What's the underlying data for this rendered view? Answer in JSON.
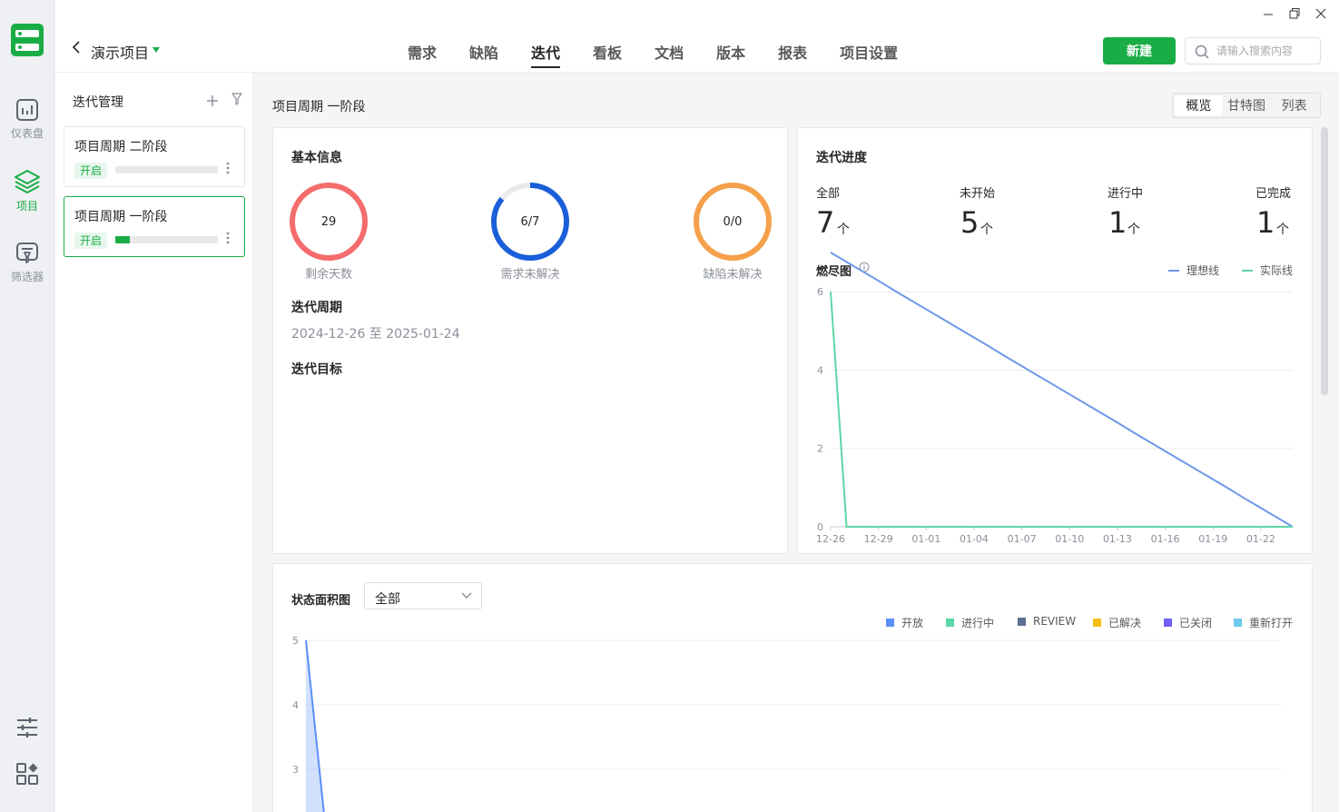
{
  "rail": {
    "items": [
      {
        "label": "仪表盘"
      },
      {
        "label": "项目"
      },
      {
        "label": "筛选器"
      }
    ]
  },
  "header": {
    "project_name": "演示项目",
    "tabs": [
      {
        "label": "需求"
      },
      {
        "label": "缺陷"
      },
      {
        "label": "迭代"
      },
      {
        "label": "看板"
      },
      {
        "label": "文档"
      },
      {
        "label": "版本"
      },
      {
        "label": "报表"
      },
      {
        "label": "项目设置"
      }
    ],
    "active_tab": "迭代",
    "new_label": "新建",
    "search_placeholder": "请输入搜索内容",
    "accent": "#1aad46"
  },
  "iterations": {
    "title": "迭代管理",
    "items": [
      {
        "name": "项目周期 二阶段",
        "status": "开启",
        "progress": 0.0
      },
      {
        "name": "项目周期 一阶段",
        "status": "开启",
        "progress": 0.14
      }
    ]
  },
  "main": {
    "breadcrumb": "项目周期 一阶段",
    "views": [
      "概览",
      "甘特图",
      "列表"
    ],
    "active_view": "概览",
    "basic": {
      "title": "基本信息",
      "rings": [
        {
          "value": "29",
          "label": "剩余天数",
          "fraction": 1.0,
          "color": "#f56c6c"
        },
        {
          "value": "6/7",
          "label": "需求未解决",
          "fraction": 0.857,
          "color": "#1a5fd9"
        },
        {
          "value": "0/0",
          "label": "缺陷未解决",
          "fraction": 1.0,
          "color": "#f5a04a"
        }
      ],
      "period_title": "迭代周期",
      "period_value": "2024-12-26 至 2025-01-24",
      "goal_title": "迭代目标"
    },
    "progress": {
      "title": "迭代进度",
      "stats": [
        {
          "label": "全部",
          "value": "7",
          "unit": "个"
        },
        {
          "label": "未开始",
          "value": "5",
          "unit": "个"
        },
        {
          "label": "进行中",
          "value": "1",
          "unit": "个"
        },
        {
          "label": "已完成",
          "value": "1",
          "unit": "个"
        }
      ],
      "burndown_title": "燃尽图"
    },
    "area": {
      "title": "状态面积图",
      "filter_value": "全部"
    }
  },
  "chart_data": [
    {
      "type": "line",
      "x": [
        "12-26",
        "12-27",
        "12-28",
        "12-29",
        "12-30",
        "12-31",
        "01-01",
        "01-02",
        "01-03",
        "01-04",
        "01-05",
        "01-06",
        "01-07",
        "01-08",
        "01-09",
        "01-10",
        "01-11",
        "01-12",
        "01-13",
        "01-14",
        "01-15",
        "01-16",
        "01-17",
        "01-18",
        "01-19",
        "01-20",
        "01-21",
        "01-22",
        "01-23",
        "01-24"
      ],
      "x_tick_labels": [
        "12-26",
        "12-29",
        "01-01",
        "01-04",
        "01-07",
        "01-10",
        "01-13",
        "01-16",
        "01-19",
        "01-22"
      ],
      "series": [
        {
          "name": "理想线",
          "color": "#6e98e8",
          "values": [
            7,
            6.76,
            6.52,
            6.28,
            6.03,
            5.79,
            5.55,
            5.31,
            5.07,
            4.83,
            4.59,
            4.34,
            4.1,
            3.86,
            3.62,
            3.38,
            3.14,
            2.9,
            2.66,
            2.41,
            2.17,
            1.93,
            1.69,
            1.45,
            1.21,
            0.97,
            0.72,
            0.48,
            0.24,
            0
          ]
        },
        {
          "name": "实际线",
          "color": "#5ed6a4",
          "values": [
            6,
            0,
            0,
            0,
            0,
            0,
            0,
            0,
            0,
            0,
            0,
            0,
            0,
            0,
            0,
            0,
            0,
            0,
            0,
            0,
            0,
            0,
            0,
            0,
            0,
            0,
            0,
            0,
            0,
            0
          ]
        }
      ],
      "y_ticks": [
        "0",
        "2",
        "4",
        "6"
      ],
      "ylim": [
        0,
        7
      ],
      "grid": true,
      "legend": "top-right"
    },
    {
      "type": "area",
      "series": [
        {
          "name": "开放",
          "color": "#5b8ff9",
          "values": [
            5,
            2.3
          ]
        },
        {
          "name": "进行中",
          "color": "#5ad8a6",
          "values": []
        },
        {
          "name": "REVIEW",
          "color": "#5d7092",
          "values": []
        },
        {
          "name": "已解决",
          "color": "#f6bd16",
          "values": []
        },
        {
          "name": "已关闭",
          "color": "#6f5ef9",
          "values": []
        },
        {
          "name": "重新打开",
          "color": "#6dc8ec",
          "values": []
        }
      ],
      "y_ticks": [
        "3",
        "4",
        "5"
      ],
      "ylim": [
        2.3,
        5
      ],
      "grid": true,
      "legend": "top-right"
    }
  ]
}
